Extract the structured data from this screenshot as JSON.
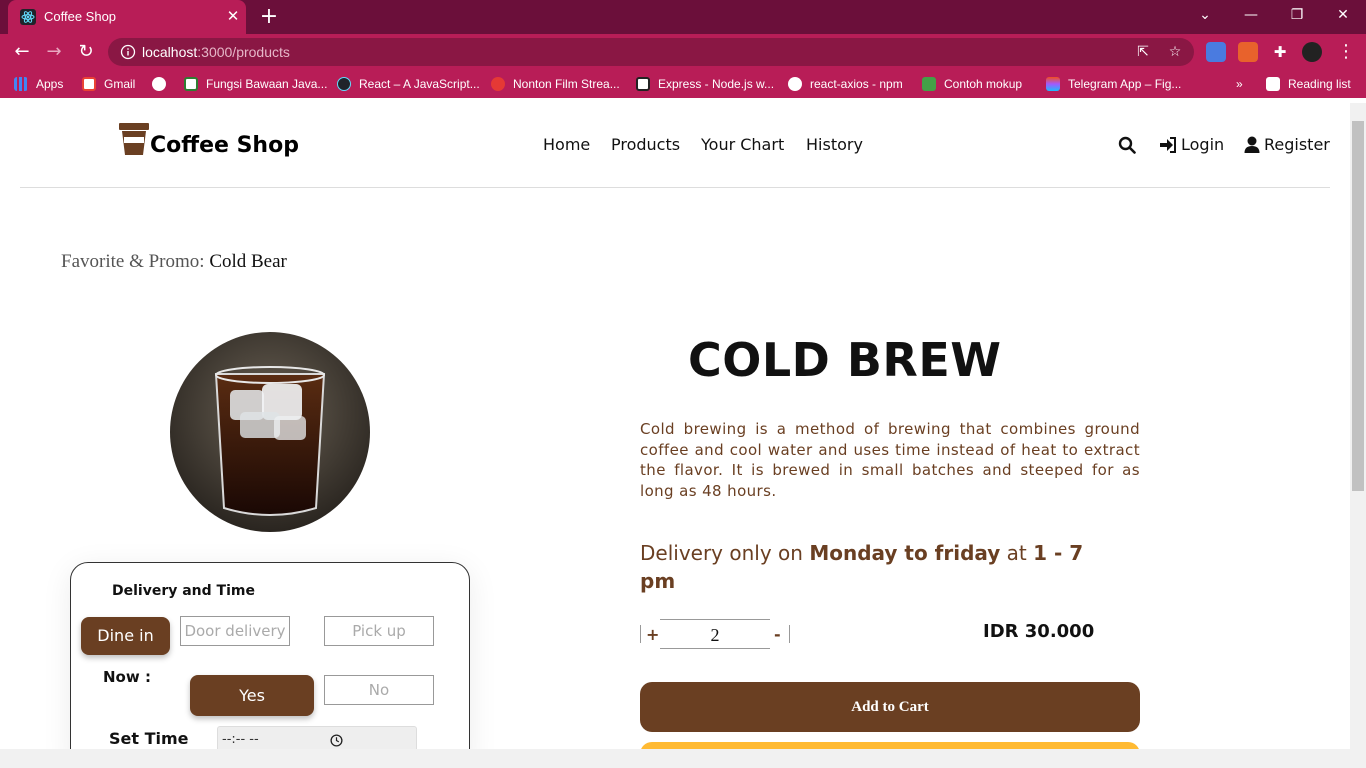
{
  "browser": {
    "tab_title": "Coffee Shop",
    "url_host": "localhost",
    "url_path": ":3000/products",
    "bookmarks": [
      {
        "label": "Apps",
        "color": "#4285f4"
      },
      {
        "label": "Gmail",
        "color": "#ea4335"
      },
      {
        "label": "",
        "color": "#ffffff"
      },
      {
        "label": "Fungsi Bawaan Java...",
        "color": "#2e7d32"
      },
      {
        "label": "React – A JavaScript...",
        "color": "#20232a"
      },
      {
        "label": "Nonton Film Strea...",
        "color": "#e53935"
      },
      {
        "label": "Express - Node.js w...",
        "color": "#222222"
      },
      {
        "label": "react-axios - npm",
        "color": "#ffffff"
      },
      {
        "label": "Contoh mokup",
        "color": "#43a047"
      },
      {
        "label": "Telegram App – Fig...",
        "color": "#a259ff"
      }
    ],
    "reading_list": "Reading list",
    "more": "»"
  },
  "header": {
    "brand": "Coffee Shop",
    "nav": [
      "Home",
      "Products",
      "Your Chart",
      "History"
    ],
    "login": "Login",
    "register": "Register"
  },
  "breadcrumb": {
    "prefix": "Favorite & Promo:",
    "current": "Cold Bear"
  },
  "delivery_card": {
    "title": "Delivery and Time",
    "options": [
      "Dine in",
      "Door delivery",
      "Pick up"
    ],
    "now_label": "Now :",
    "now_options": [
      "Yes",
      "No"
    ],
    "set_time_label": "Set Time",
    "time_value": "--:--  --"
  },
  "product": {
    "name": "COLD BREW",
    "description": "Cold brewing is a method of brewing that combines ground coffee and cool water and uses time instead of heat to extract the flavor. It is brewed in small batches and steeped for as long as 48 hours.",
    "delivery_prefix": "Delivery only on ",
    "delivery_days": "Monday to friday",
    "delivery_mid": " at ",
    "delivery_hours": "1 - 7 pm",
    "qty_plus": "+",
    "qty_minus": "-",
    "quantity": "2",
    "price": "IDR 30.000",
    "add_to_cart": "Add to Cart"
  },
  "colors": {
    "brand_brown": "#6a3f22",
    "accent_yellow": "#ffba33",
    "chrome_pink": "#b81d57",
    "chrome_dark": "#6b0f3a"
  }
}
